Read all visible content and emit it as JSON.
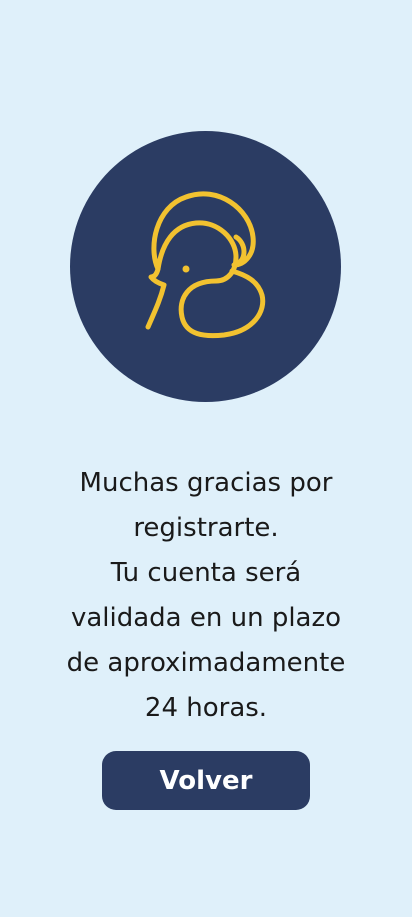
{
  "logo": {
    "icon": "elephant-s-logo",
    "circle_color": "#2b3c63",
    "stroke_color": "#f2c230"
  },
  "message": {
    "lines": [
      "Muchas gracias por",
      "registrarte.",
      "Tu cuenta será",
      "validada en un plazo",
      "de aproximadamente",
      "24 horas."
    ]
  },
  "button": {
    "label": "Volver",
    "color": "#2b3c63"
  },
  "background_color": "#dff0fa"
}
